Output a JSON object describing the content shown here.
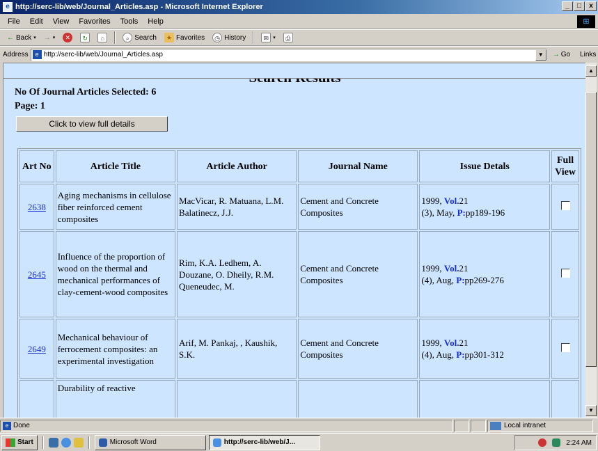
{
  "window": {
    "title": "http://serc-lib/web/Journal_Articles.asp - Microsoft Internet Explorer",
    "buttons": {
      "minimize": "_",
      "maximize": "□",
      "close": "x"
    }
  },
  "menu": [
    "File",
    "Edit",
    "View",
    "Favorites",
    "Tools",
    "Help"
  ],
  "toolbar": {
    "back": "Back",
    "forward": "→",
    "search": "Search",
    "favorites": "Favorites",
    "history": "History"
  },
  "address": {
    "label": "Address",
    "url": "http://serc-lib/web/Journal_Articles.asp",
    "go": "Go",
    "links": "Links"
  },
  "page": {
    "title": "Search Results",
    "count_text": "No Of Journal Articles Selected: 6",
    "page_text": "Page: 1",
    "view_button": "Click to view full details"
  },
  "table": {
    "headers": [
      "Art No",
      "Article Title",
      "Article Author",
      "Journal Name",
      "Issue Detals",
      "Full View"
    ],
    "rows": [
      {
        "art_no": "2638",
        "title": "Aging mechanisms in cellulose fiber reinforced cement composites",
        "author": "MacVicar, R. Matuana, L.M. Balatinecz, J.J.",
        "journal": "Cement and Concrete Composites",
        "year": "1999, ",
        "vol_label": "Vol.",
        "vol": "21",
        "issue": "(3), May, ",
        "p_label": "P:",
        "pages": "pp189-196"
      },
      {
        "art_no": "2645",
        "title": "Influence of the proportion of wood on the thermal and mechanical performances of clay-cement-wood composites",
        "author": "Rim, K.A. Ledhem, A. Douzane, O. Dheily, R.M. Queneudec, M.",
        "journal": "Cement and Concrete Composites",
        "year": "1999, ",
        "vol_label": "Vol.",
        "vol": "21",
        "issue": "(4), Aug, ",
        "p_label": "P:",
        "pages": "pp269-276"
      },
      {
        "art_no": "2649",
        "title": "Mechanical behaviour of ferrocement composites: an experimental investigation",
        "author": "Arif, M. Pankaj, , Kaushik, S.K.",
        "journal": "Cement and Concrete Composites",
        "year": "1999, ",
        "vol_label": "Vol.",
        "vol": "21",
        "issue": "(4), Aug, ",
        "p_label": "P:",
        "pages": "pp301-312"
      },
      {
        "art_no": "",
        "title": "Durability of reactive",
        "author": "",
        "journal": "",
        "year": "",
        "vol_label": "",
        "vol": "",
        "issue": "",
        "p_label": "",
        "pages": ""
      }
    ]
  },
  "status": {
    "text": "Done",
    "zone": "Local intranet"
  },
  "taskbar": {
    "start": "Start",
    "task1": "Microsoft Word",
    "task2": "http://serc-lib/web/J...",
    "clock": "2:24 AM"
  }
}
